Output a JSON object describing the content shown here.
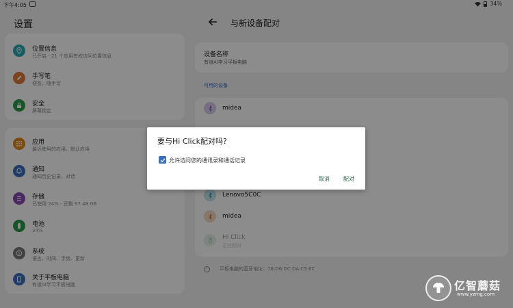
{
  "status_bar": {
    "time": "下午4:05",
    "battery": "34%"
  },
  "left": {
    "title": "设置",
    "group1": [
      {
        "title": "位置信息",
        "subtitle": "已开启 - 21 个应用有权访问位置信息",
        "icon": "location-icon",
        "color": "#2aa7b5"
      },
      {
        "title": "手写笔",
        "subtitle": "便签、随手写",
        "icon": "pen-icon",
        "color": "#e07a3a"
      },
      {
        "title": "安全",
        "subtitle": "屏幕锁定",
        "icon": "lock-icon",
        "color": "#2a9a4a"
      }
    ],
    "group2": [
      {
        "title": "应用",
        "subtitle": "最近使用的应用、默认应用",
        "icon": "apps-icon",
        "color": "#e08a1a"
      },
      {
        "title": "通知",
        "subtitle": "通知历史记录、对话",
        "icon": "bell-icon",
        "color": "#3b6ebd"
      },
      {
        "title": "存储",
        "subtitle": "已使用 24% - 还剩 97.48 GB",
        "icon": "storage-icon",
        "color": "#8a4ab5"
      },
      {
        "title": "电池",
        "subtitle": "34%",
        "icon": "battery-icon",
        "color": "#2a9a4a"
      },
      {
        "title": "系统",
        "subtitle": "语言、时间、手势、更新",
        "icon": "info-icon",
        "color": "#777777"
      },
      {
        "title": "关于平板电脑",
        "subtitle": "有道AI学习平板电脑",
        "icon": "tablet-icon",
        "color": "#3b6ebd"
      }
    ]
  },
  "right": {
    "title": "与新设备配对",
    "device_name_label": "设备名称",
    "device_name_value": "有道AI学习平板电脑",
    "section_label": "可用的设备",
    "devices": [
      {
        "name": "midea",
        "sub": "",
        "icon": "bluetooth-icon",
        "color": "#8a6ab5"
      },
      {
        "name": "Lenovo5C0C",
        "sub": "",
        "icon": "bluetooth-icon",
        "color": "#2aa7b5"
      },
      {
        "name": "midea",
        "sub": "",
        "icon": "bluetooth-icon",
        "color": "#e07a3a"
      },
      {
        "name": "Hi Click",
        "sub": "正在配对",
        "icon": "mouse-icon",
        "color": "#2a9a4a"
      }
    ],
    "footer": "平板电脑的蓝牙地址：78:D6:DC:DA:C5:EC"
  },
  "dialog": {
    "title": "要与Hi Click配对吗?",
    "checkbox_label": "允许访问您的通讯录和通话记录",
    "checkbox_checked": true,
    "cancel_label": "取消",
    "pair_label": "配对"
  },
  "watermark": {
    "text": "亿智蘑菇",
    "url": "www.yzmg.com"
  }
}
